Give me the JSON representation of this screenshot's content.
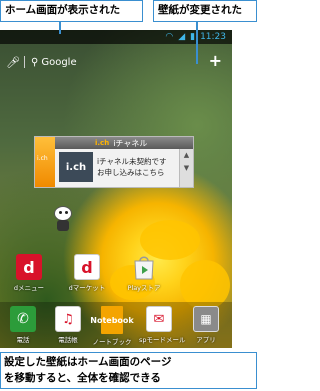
{
  "callouts": {
    "home_shown": "ホーム画面が表示された",
    "wallpaper_changed": "壁紙が変更された"
  },
  "status_bar": {
    "time": "11:23",
    "icons": [
      "wifi-icon",
      "signal-icon",
      "battery-icon"
    ]
  },
  "search_bar": {
    "label": "Google",
    "icons": [
      "mic-icon",
      "search-icon",
      "plus-icon"
    ]
  },
  "widget": {
    "title": "iチャネル",
    "logo_text": "i.ch",
    "side_text": "i.ch",
    "line1": "iチャネル未契約です",
    "line2": "お申し込みはこちら"
  },
  "apps_row": [
    {
      "icon": "d",
      "label": "dメニュー"
    },
    {
      "icon": "d",
      "label": "dマーケット"
    },
    {
      "icon": "▶",
      "label": "Playストア"
    }
  ],
  "dock": [
    {
      "icon": "✆",
      "label": "電話"
    },
    {
      "icon": "♫",
      "label": "電話帳"
    },
    {
      "icon": "Notebook",
      "label": "ノートブック"
    },
    {
      "icon": "✉",
      "label": "spモードメール"
    },
    {
      "icon": "▦",
      "label": "アプリ"
    }
  ],
  "caption": {
    "line1": "設定した壁紙はホーム画面のページ",
    "line2": "を移動すると、全体を確認できる"
  },
  "colors": {
    "callout_border": "#3a8fd0",
    "docomo_red": "#d8122a",
    "status_accent": "#3fb6e8"
  }
}
